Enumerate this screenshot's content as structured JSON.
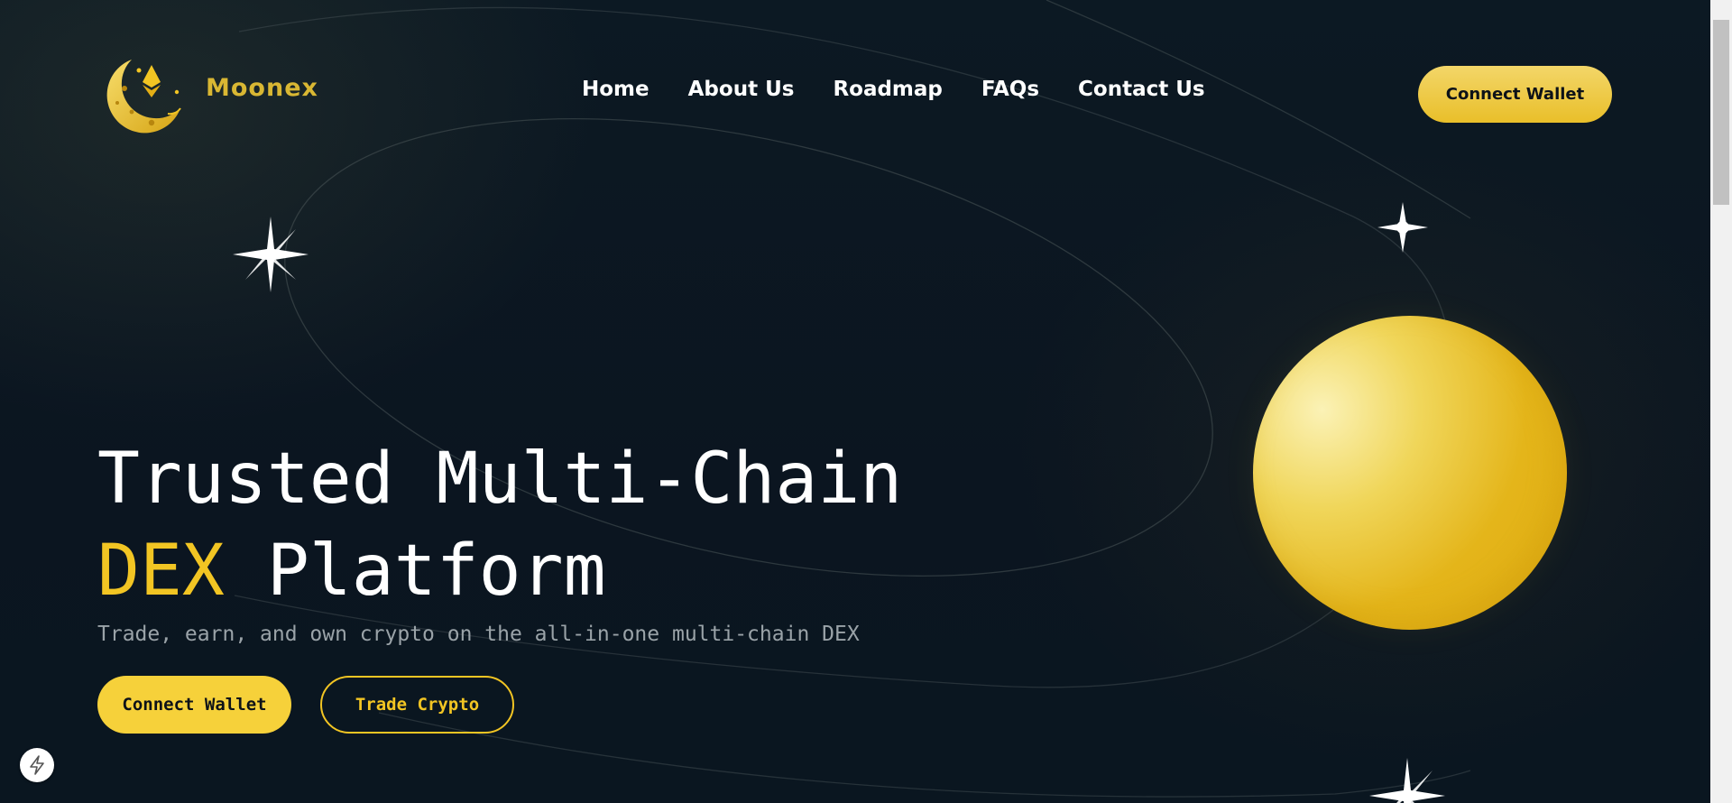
{
  "brand": {
    "name": "Moonex",
    "logo_icon": "crescent-moon-ethereum-logo",
    "color": "#d9b733"
  },
  "nav": {
    "items": [
      {
        "label": "Home"
      },
      {
        "label": "About Us"
      },
      {
        "label": "Roadmap"
      },
      {
        "label": "FAQs"
      },
      {
        "label": "Contact Us"
      }
    ]
  },
  "header": {
    "connect_label": "Connect Wallet"
  },
  "hero": {
    "title_line1": "Trusted Multi-Chain",
    "title_accent": "DEX",
    "title_rest": " Platform",
    "subtitle": "Trade, earn, and own crypto on the all-in-one multi-chain DEX",
    "primary_label": "Connect Wallet",
    "secondary_label": "Trade Crypto"
  },
  "decor": {
    "planet": "golden-planet",
    "stars": [
      "sparkle-star-icon",
      "sparkle-star-icon",
      "sparkle-star-icon"
    ]
  },
  "colors": {
    "background": "#0b1622",
    "accent": "#f2c523",
    "text": "#ffffff",
    "muted": "#9aa3a8"
  },
  "floating_badge": {
    "icon": "lightning-bolt-icon"
  }
}
